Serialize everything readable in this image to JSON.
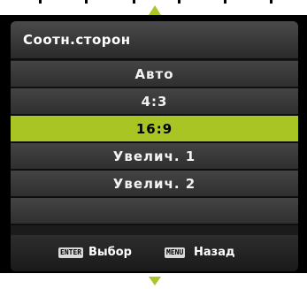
{
  "menu": {
    "title": "Соотн.сторон",
    "options": [
      "Авто",
      "4:3",
      "16:9",
      "Увелич. 1",
      "Увелич. 2",
      ""
    ],
    "selected_index": 2
  },
  "footer": {
    "enter_key": "ENTER",
    "enter_label": "Выбор",
    "menu_key": "MENU",
    "menu_label": "Назад"
  },
  "colors": {
    "accent": "#a9c523"
  },
  "icons": {
    "scroll_up": "triangle-up",
    "scroll_down": "triangle-down"
  }
}
